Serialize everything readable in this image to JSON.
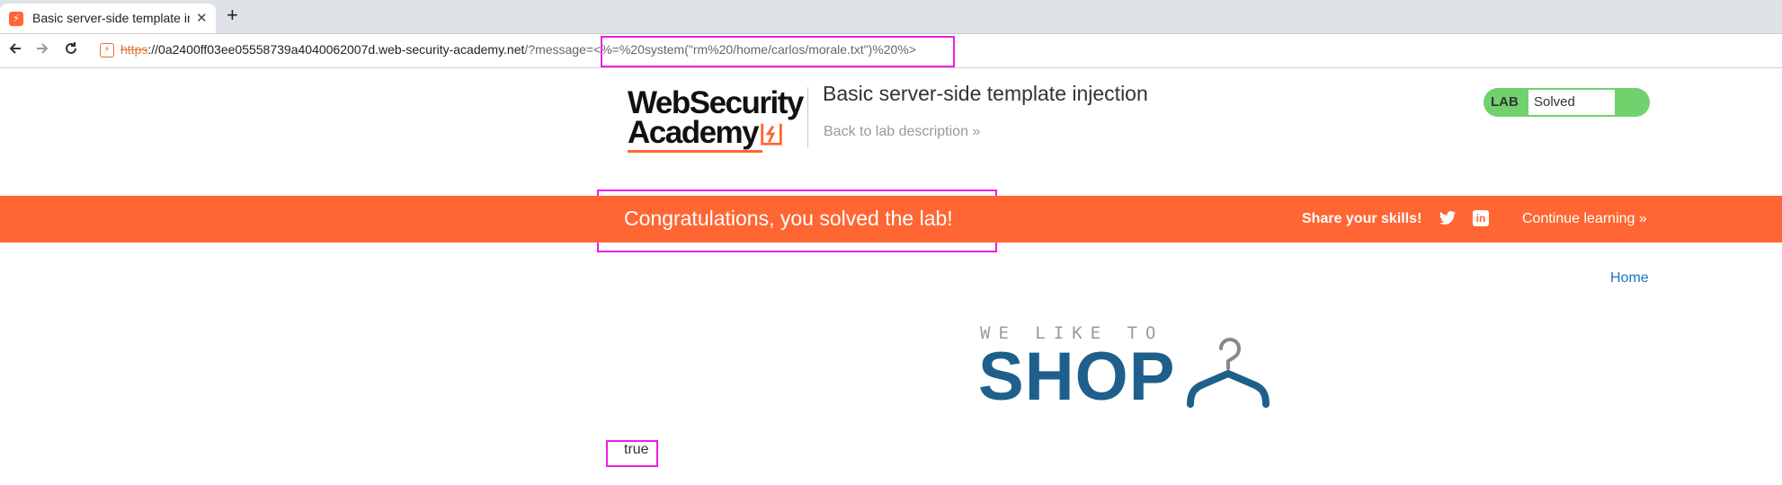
{
  "browser": {
    "tab_title": "Basic server-side template injection",
    "tab_close": "✕",
    "new_tab": "+",
    "tab_favicon": "⚡",
    "site_icon": "⚡",
    "url_protocol": "https",
    "url_host": "://0a2400ff03ee05558739a4040062007d.web-security-academy.net",
    "url_path": "/?message=<%=%20system(\"rm%20/home/carlos/morale.txt\")%20%>",
    "icons": [
      "back-arrow-icon",
      "forward-arrow-icon",
      "reload-icon"
    ]
  },
  "header": {
    "logo_line1": "WebSecurity",
    "logo_line2": "Academy",
    "lab_title": "Basic server-side template injection",
    "back_link": "Back to lab description »",
    "badge_label": "LAB",
    "badge_status": "Solved"
  },
  "banner": {
    "message": "Congratulations, you solved the lab!",
    "share_text": "Share your skills!",
    "linkedin_glyph": "in",
    "continue_link": "Continue learning »"
  },
  "content": {
    "home_link": "Home",
    "shop_tagline": "WE LIKE TO",
    "shop_word": "SHOP",
    "result_text": "true"
  },
  "colors": {
    "accent_orange": "#ff6633",
    "badge_green": "#70d16d",
    "link_blue": "#1a76c7",
    "shop_blue": "#1f5f8b",
    "highlight_magenta": "#ee1ee0"
  }
}
